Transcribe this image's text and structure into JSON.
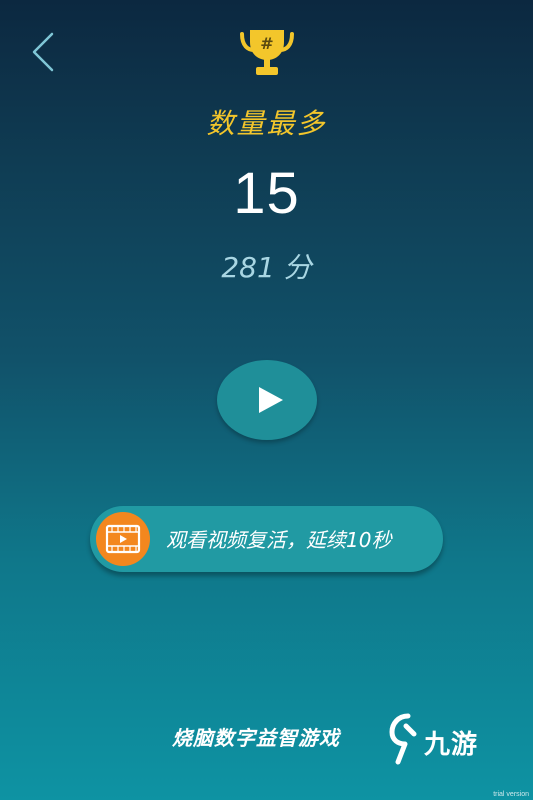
{
  "header": {
    "back_icon": "chevron-left-icon",
    "trophy_icon": "trophy-icon",
    "trophy_symbol": "#"
  },
  "result": {
    "mode_title": "数量最多",
    "count": "15",
    "points": "281 分"
  },
  "actions": {
    "play_icon": "play-icon",
    "revive_label": "观看视频复活，延续10秒",
    "revive_icon": "video-icon"
  },
  "footer": {
    "tagline": "烧脑数字益智游戏",
    "brand_name": "九游",
    "watermark": "trial version"
  },
  "colors": {
    "accent": "#f3c62b",
    "revive_icon_bg": "#f3871e",
    "button_bg": "#219aa3"
  }
}
